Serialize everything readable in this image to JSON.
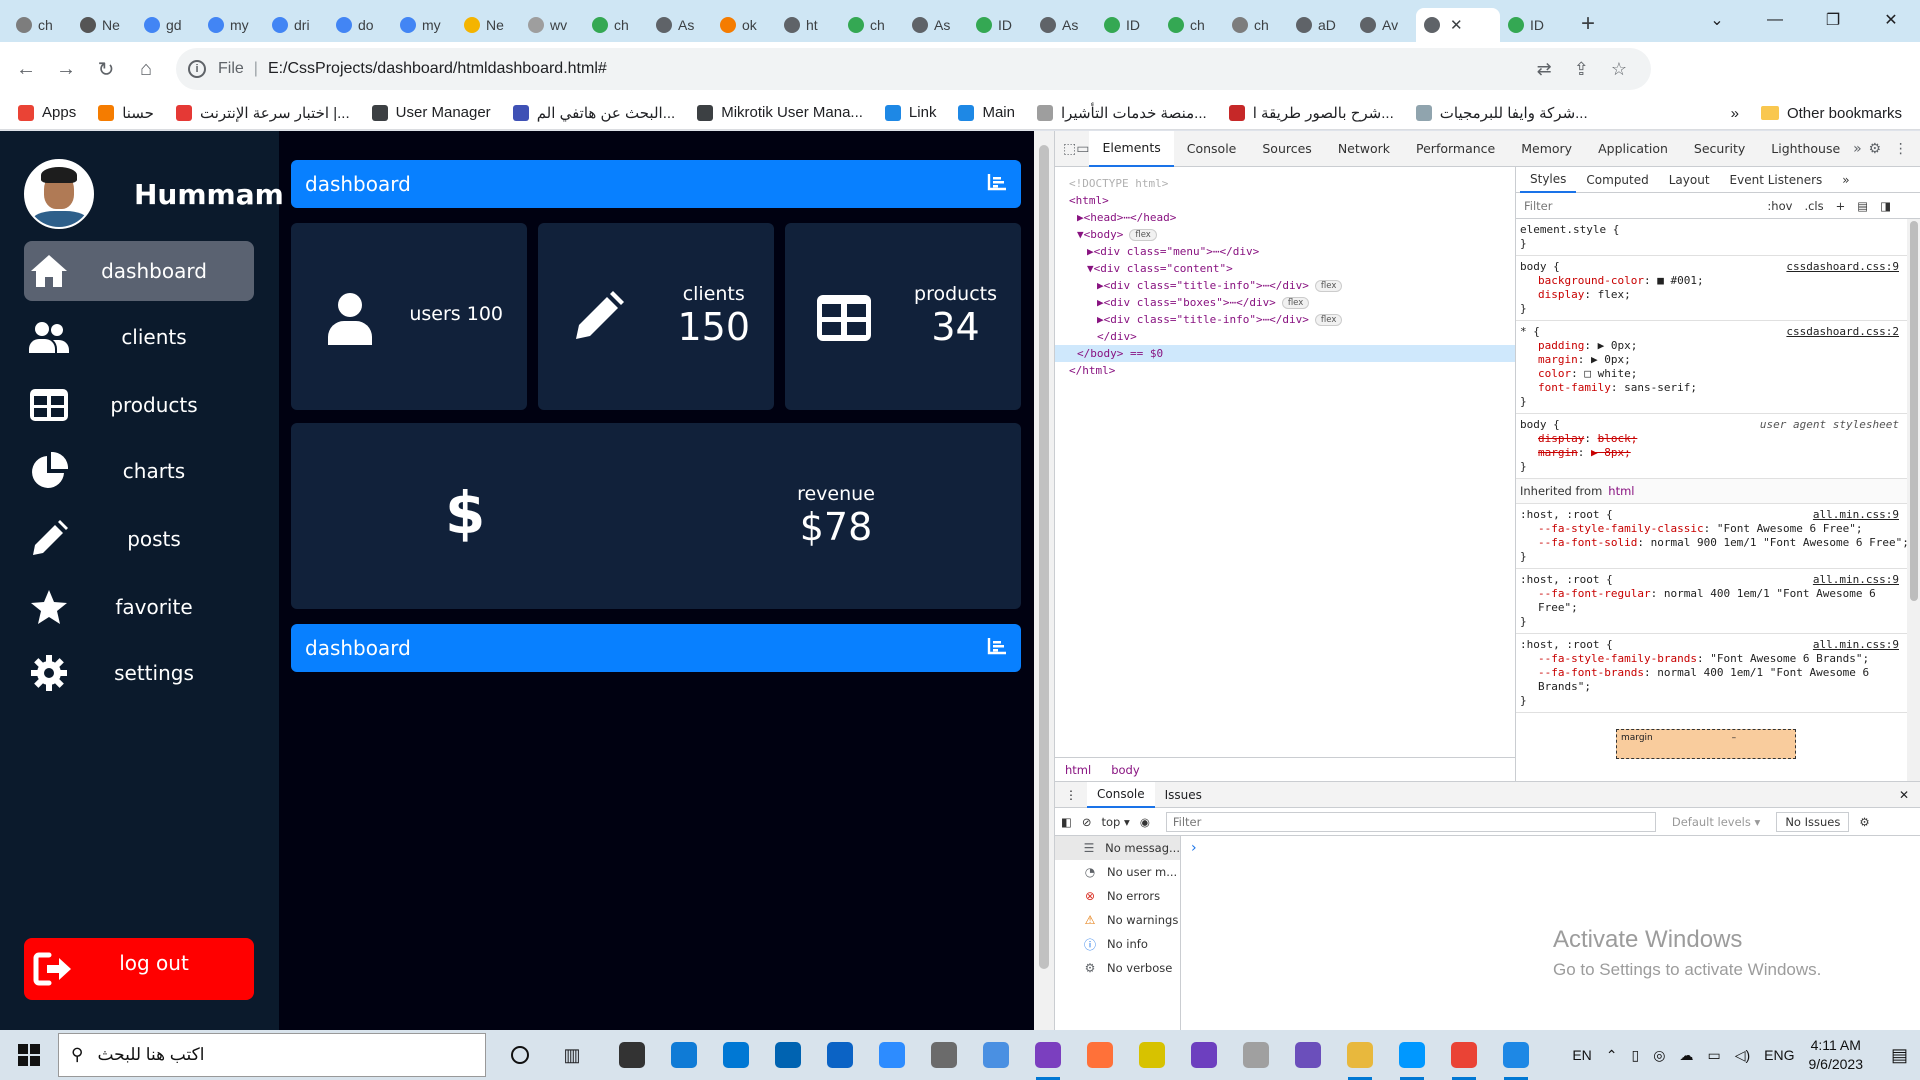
{
  "browser": {
    "tabs": [
      {
        "title": "ch",
        "color": "#7d7d7d"
      },
      {
        "title": "Ne",
        "color": "#555555"
      },
      {
        "title": "gd",
        "color": "#4285f4"
      },
      {
        "title": "my",
        "color": "#4285f4"
      },
      {
        "title": "dri",
        "color": "#4285f4"
      },
      {
        "title": "do",
        "color": "#4285f4"
      },
      {
        "title": "my",
        "color": "#4285f4"
      },
      {
        "title": "Ne",
        "color": "#f4b400"
      },
      {
        "title": "wv",
        "color": "#9e9e9e"
      },
      {
        "title": "ch",
        "color": "#34a853"
      },
      {
        "title": "As",
        "color": "#5f6368"
      },
      {
        "title": "ok",
        "color": "#f57c00"
      },
      {
        "title": "ht",
        "color": "#5f6368"
      },
      {
        "title": "ch",
        "color": "#34a853"
      },
      {
        "title": "As",
        "color": "#5f6368"
      },
      {
        "title": "ID",
        "color": "#34a853"
      },
      {
        "title": "As",
        "color": "#5f6368"
      },
      {
        "title": "ID",
        "color": "#34a853"
      },
      {
        "title": "ch",
        "color": "#34a853"
      },
      {
        "title": "ch",
        "color": "#7d7d7d"
      },
      {
        "title": "aD",
        "color": "#5f6368"
      },
      {
        "title": "Av",
        "color": "#5f6368"
      }
    ],
    "active_tab": {
      "title": "",
      "close": "✕"
    },
    "after_tab": {
      "title": "ID"
    },
    "new_tab": "+",
    "address": {
      "scheme": "File",
      "separator": "|",
      "url": "E:/CssProjects/dashboard/htmldashboard.html#"
    },
    "bookmarks": [
      {
        "label": "Apps",
        "color": "#ea4335"
      },
      {
        "label": "حسنا",
        "color": "#f57c00"
      },
      {
        "label": "اختبار سرعة الإنترنت |...",
        "color": "#e53935"
      },
      {
        "label": "User Manager",
        "color": "#3c4043"
      },
      {
        "label": "البحث عن هاتفي الم...",
        "color": "#3f51b5"
      },
      {
        "label": "Mikrotik User Mana...",
        "color": "#3c4043"
      },
      {
        "label": "Link",
        "color": "#1e88e5"
      },
      {
        "label": "Main",
        "color": "#1e88e5"
      },
      {
        "label": "منصة خدمات التأشيرا...",
        "color": "#9e9e9e"
      },
      {
        "label": "شرح بالصور طريقة ا...",
        "color": "#c62828"
      },
      {
        "label": "شركة وايفا للبرمجيات...",
        "color": "#90a4ae"
      }
    ],
    "bookmarks_more": "»",
    "other_bookmarks": "Other bookmarks"
  },
  "dashboard": {
    "username": "Hummam",
    "menu": [
      {
        "label": "dashboard",
        "icon": "home-icon",
        "active": true
      },
      {
        "label": "clients",
        "icon": "users-icon"
      },
      {
        "label": "products",
        "icon": "table-icon"
      },
      {
        "label": "charts",
        "icon": "pie-chart-icon"
      },
      {
        "label": "posts",
        "icon": "pencil-icon"
      },
      {
        "label": "favorite",
        "icon": "star-icon"
      },
      {
        "label": "settings",
        "icon": "gear-icon"
      }
    ],
    "logout": "log out",
    "title_bar": "dashboard",
    "boxes": [
      {
        "label": "users 100",
        "value": "",
        "icon": "user-icon"
      },
      {
        "label": "clients",
        "value": "150",
        "icon": "pencil-icon"
      },
      {
        "label": "products",
        "value": "34",
        "icon": "table-icon"
      }
    ],
    "revenue": {
      "label": "revenue",
      "value": "$78",
      "icon": "dollar-icon",
      "symbol": "$"
    },
    "footer_bar": "dashboard",
    "colors": {
      "accent": "#0880ff",
      "sidebar": "#0b1a2c",
      "box": "#11213a",
      "body": "#000111",
      "logout": "#ff0000"
    }
  },
  "devtools": {
    "tabs": [
      "Elements",
      "Console",
      "Sources",
      "Network",
      "Performance",
      "Memory",
      "Application",
      "Security",
      "Lighthouse"
    ],
    "more": "»",
    "dom": [
      {
        "text": "<!DOCTYPE html>"
      },
      {
        "text": "<html>"
      },
      {
        "text": "▶<head>⋯</head>"
      },
      {
        "text": "▼<body>",
        "pill": "flex"
      },
      {
        "text": "▶<div class=\"menu\">⋯</div>"
      },
      {
        "text": "▼<div class=\"content\">"
      },
      {
        "text": "▶<div class=\"title-info\">⋯</div>",
        "pill": "flex"
      },
      {
        "text": "▶<div class=\"boxes\">⋯</div>",
        "pill": "flex"
      },
      {
        "text": "▶<div class=\"title-info\">⋯</div>",
        "pill": "flex"
      },
      {
        "text": "</div>"
      },
      {
        "text": "</body> == $0"
      },
      {
        "text": "</html>"
      }
    ],
    "breadcrumb": [
      "html",
      "body"
    ],
    "styles_tabs": [
      "Styles",
      "Computed",
      "Layout",
      "Event Listeners"
    ],
    "styles_more": "»",
    "filter_placeholder": "Filter",
    "hov": ":hov",
    "cls": ".cls",
    "rules": [
      {
        "selector": "element.style {",
        "src": "",
        "props": [],
        "close": "}"
      },
      {
        "selector": "body {",
        "src": "cssdashoard.css:9",
        "props": [
          [
            "background-color",
            "■ #001;"
          ],
          [
            "display",
            "flex;"
          ]
        ],
        "close": "}"
      },
      {
        "selector": "* {",
        "src": "cssdashoard.css:2",
        "props": [
          [
            "padding",
            "▶ 0px;"
          ],
          [
            "margin",
            "▶ 0px;"
          ],
          [
            "color",
            "□ white;"
          ],
          [
            "font-family",
            "sans-serif;"
          ]
        ],
        "close": "}"
      },
      {
        "selector": "body {",
        "src": "user agent stylesheet",
        "ua": true,
        "props": [
          [
            "display",
            "block;"
          ],
          [
            "margin",
            "▶ 8px;"
          ]
        ],
        "strike": true,
        "close": "}"
      }
    ],
    "inherited_label": "Inherited from",
    "inherited_tag": "html",
    "rules2": [
      {
        "selector": ":host, :root {",
        "src": "all.min.css:9",
        "props": [
          [
            "--fa-style-family-classic",
            "\"Font Awesome 6 Free\";"
          ],
          [
            "--fa-font-solid",
            "normal 900 1em/1 \"Font Awesome 6 Free\";"
          ]
        ],
        "close": "}"
      },
      {
        "selector": ":host, :root {",
        "src": "all.min.css:9",
        "props": [
          [
            "--fa-font-regular",
            "normal 400 1em/1 \"Font Awesome 6 Free\";"
          ]
        ],
        "close": "}"
      },
      {
        "selector": ":host, :root {",
        "src": "all.min.css:9",
        "props": [
          [
            "--fa-style-family-brands",
            "\"Font Awesome 6 Brands\";"
          ],
          [
            "--fa-font-brands",
            "normal 400 1em/1 \"Font Awesome 6 Brands\";"
          ]
        ],
        "close": "}"
      }
    ],
    "box_model": "margin",
    "box_model_dash": "–",
    "console": {
      "tabs": [
        "Console",
        "Issues"
      ],
      "context": "top",
      "filter": "Filter",
      "levels": "Default levels ▾",
      "issues": "No Issues",
      "sidebar": [
        "No messag...",
        "No user m...",
        "No errors",
        "No warnings",
        "No info",
        "No verbose"
      ],
      "prompt": "›"
    }
  },
  "watermark": {
    "line1": "Activate Windows",
    "line2": "Go to Settings to activate Windows."
  },
  "taskbar": {
    "search_text": "اكتب هنا للبحث",
    "lang": "EN",
    "input_lang": "ENG",
    "time": "4:11 AM",
    "date": "9/6/2023",
    "apps": [
      "#333333",
      "#0f7bd6",
      "#0078d4",
      "#0063b1",
      "#0b63c5",
      "#2d8cff",
      "#6b6b6b",
      "#4a90e2",
      "#7b3fbf",
      "#ff7139",
      "#d7c200",
      "#6d3fbf",
      "#a0a0a0",
      "#6b4fbb",
      "#e8b83d",
      "#0098ff",
      "#ea4335",
      "#1e88e5"
    ]
  }
}
